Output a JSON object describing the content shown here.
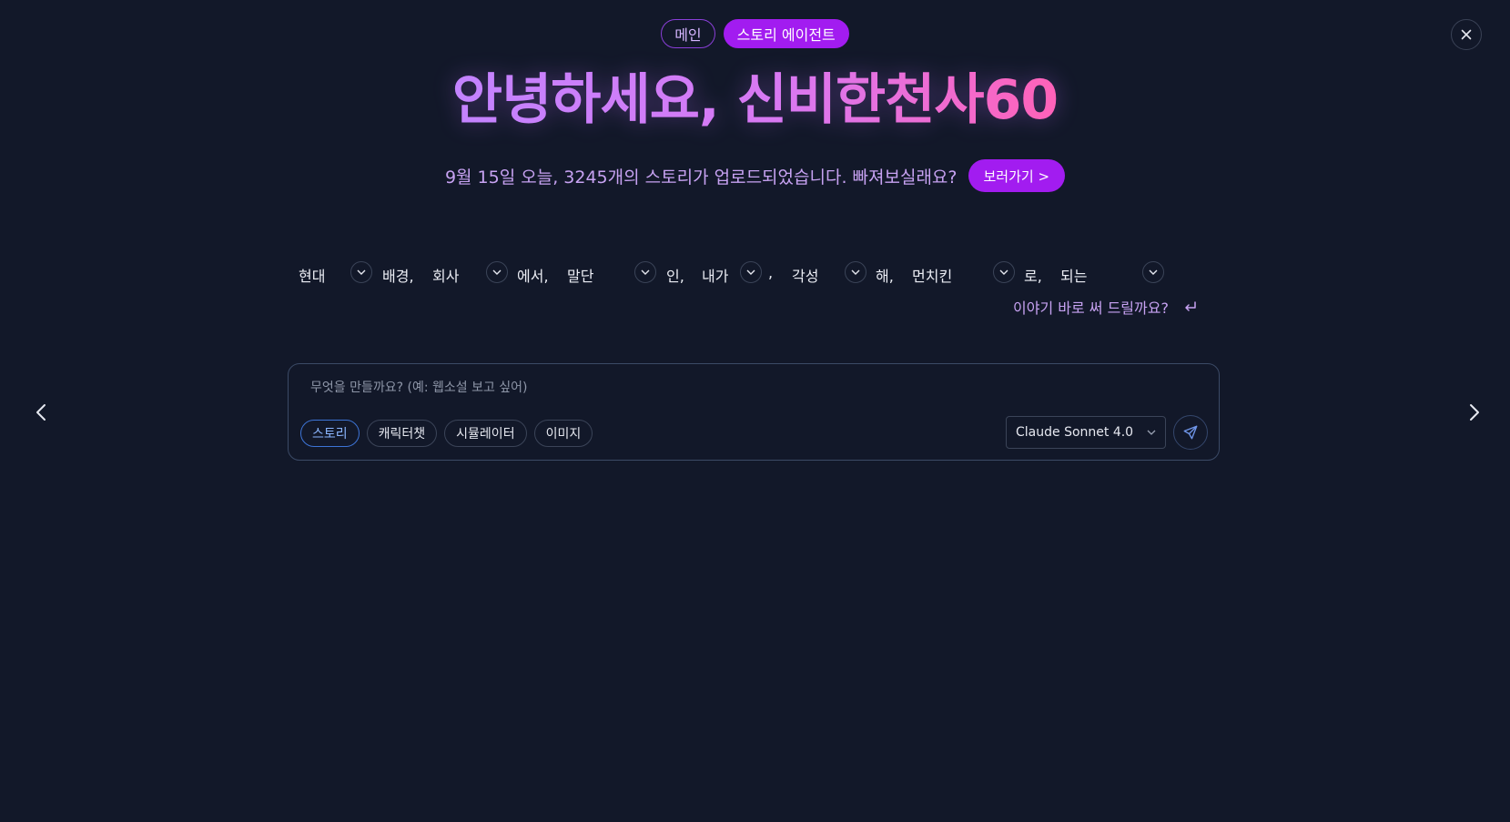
{
  "header": {
    "tabs": [
      {
        "label": "메인",
        "active": false
      },
      {
        "label": "스토리 에이전트",
        "active": true
      }
    ],
    "close_icon": "close-icon"
  },
  "hero": {
    "title": "안녕하세요, 신비한천사60",
    "subtitle": "9월 15일 오늘, 3245개의 스토리가 업로드되었습니다. 빠져보실래요?",
    "go_button": "보러가기 >"
  },
  "prompt_builder": {
    "items": [
      {
        "text": "현대",
        "dropdown": true
      },
      {
        "text": "배경,",
        "dropdown": false
      },
      {
        "text": "회사",
        "dropdown": true
      },
      {
        "text": "에서,",
        "dropdown": false
      },
      {
        "text": "말단",
        "dropdown": true
      },
      {
        "text": "인,",
        "dropdown": false
      },
      {
        "text": "내가",
        "dropdown": true
      },
      {
        "text": ",",
        "dropdown": false
      },
      {
        "text": "각성",
        "dropdown": true
      },
      {
        "text": "해,",
        "dropdown": false
      },
      {
        "text": "먼치킨",
        "dropdown": true
      },
      {
        "text": "로,",
        "dropdown": false
      },
      {
        "text": "되는",
        "dropdown": true
      }
    ],
    "instant_label": "이야기 바로 써 드릴까요?",
    "enter_icon": "return-icon"
  },
  "composer": {
    "placeholder": "무엇을 만들까요? (예: 웹소설 보고 싶어)",
    "value": "",
    "types": [
      {
        "label": "스토리",
        "active": true
      },
      {
        "label": "캐릭터챗",
        "active": false
      },
      {
        "label": "시뮬레이터",
        "active": false
      },
      {
        "label": "이미지",
        "active": false
      }
    ],
    "model": "Claude Sonnet 4.0",
    "send_icon": "send-icon"
  },
  "navigation": {
    "prev_icon": "chevron-left-icon",
    "next_icon": "chevron-right-icon"
  },
  "colors": {
    "background": "#121829",
    "accent": "#a21cf0",
    "title_gradient_start": "#c383ff",
    "title_gradient_end": "#ff62b8",
    "subtitle": "#c7a2f2",
    "active_chip": "#3d74d6"
  }
}
